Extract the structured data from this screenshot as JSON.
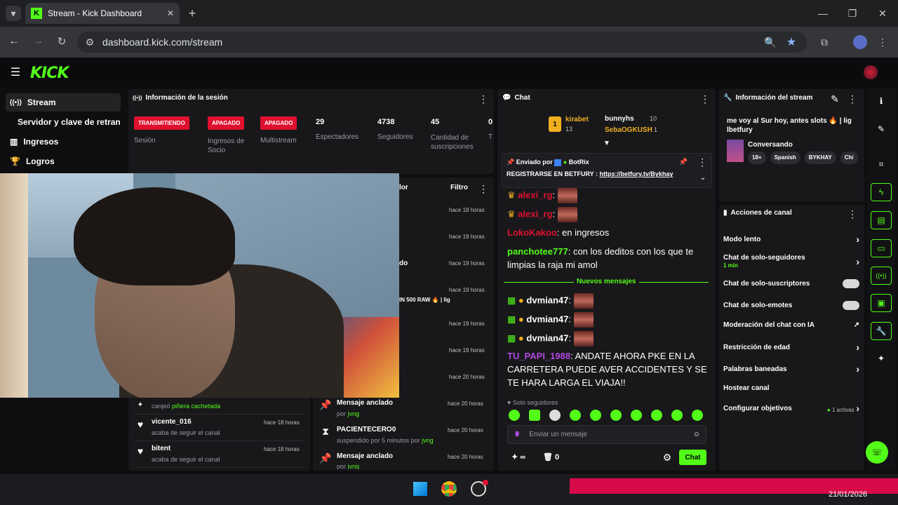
{
  "browser": {
    "tab_title": "Stream - Kick Dashboard",
    "url": "dashboard.kick.com/stream"
  },
  "nav": {
    "items": [
      "Stream",
      "Servidor y clave de retransm",
      "Ingresos",
      "Logros"
    ]
  },
  "session": {
    "title": "Información de la sesión",
    "stats": [
      {
        "badge": "TRANSMITIENDO",
        "label": "Sesión"
      },
      {
        "badge": "APAGADO",
        "label": "Ingresos de Socio"
      },
      {
        "badge": "APAGADO",
        "label": "Multistream"
      },
      {
        "value": "29",
        "label": "Espectadores"
      },
      {
        "value": "4738",
        "label": "Seguidores"
      },
      {
        "value": "45",
        "label": "Cantidad de suscripciones"
      },
      {
        "value": "0",
        "label": "T"
      }
    ]
  },
  "activity": {
    "filter": "Filtro",
    "header_frag": "lor",
    "right": [
      {
        "ago": "hace 18 horas"
      },
      {
        "ago": "hace 19 horas"
      },
      {
        "ago": "hace 19 horas",
        "frag": "do"
      },
      {
        "ago": "hace 19 horas",
        "frag": "IN 500 RAW 🔥 | lig"
      },
      {
        "ago": "hace 19 horas"
      },
      {
        "ago": "hace 19 horas"
      },
      {
        "ago": "hace 20 horas"
      },
      {
        "ago": "hace 20 horas",
        "name": "Mensaje anclado",
        "sub": "por",
        "subuser": "jvng"
      },
      {
        "ago": "hace 20 horas",
        "name": "PACIENTECERO0",
        "sub": "suspendido por 5 minutos por",
        "subuser": "jvng"
      },
      {
        "ago": "hace 20 horas",
        "name": "Mensaje anclado",
        "sub": "por",
        "subuser": "jvng"
      }
    ],
    "left": [
      {
        "name": "",
        "sub": "canjeó",
        "subuser": "piñera cachetada",
        "ago": ""
      },
      {
        "name": "vicente_016",
        "sub": "acaba de seguir el canal",
        "ago": "hace 18 horas"
      },
      {
        "name": "bitent",
        "sub": "acaba de seguir el canal",
        "ago": "hace 18 horas"
      }
    ]
  },
  "chat": {
    "title": "Chat",
    "top": [
      {
        "name": "kirabet",
        "count": "13",
        "rank": "1"
      },
      {
        "name": "bunnyhs",
        "count": "10"
      },
      {
        "name": "SebaOGKUSH",
        "count": "1"
      }
    ],
    "pinned": {
      "sent_by": "Enviado por",
      "bot": "BotRix",
      "text": "REGISTRARSE EN BETFURY : ",
      "link": "https://betfury.tv/Bykhay"
    },
    "messages": [
      {
        "user": "alexi_rg",
        "color": "#e0102f",
        "text": ""
      },
      {
        "user": "alexi_rg",
        "color": "#e0102f",
        "text": ""
      },
      {
        "user": "LokoKakoo",
        "color": "#e0102f",
        "text": "en ingresos"
      },
      {
        "user": "panchotee777",
        "color": "#53fc18",
        "text": "con los deditos con los que te limpias la raja mi amol"
      }
    ],
    "new_label": "Nuevos mensajes",
    "new_messages": [
      {
        "user": "dvmian47",
        "text": ""
      },
      {
        "user": "dvmian47",
        "text": ""
      },
      {
        "user": "dvmian47",
        "text": ""
      },
      {
        "user": "TU_PAPI_1988",
        "text": "ANDATE AHORA PKE EN LA CARRETERA PUEDE AVER ACCIDENTES Y SE TE HARA LARGA EL VIAJA!!"
      }
    ],
    "followers_only": "Solo seguidores",
    "input_placeholder": "Enviar un mensaje",
    "count": "0",
    "send": "Chat"
  },
  "stream_info": {
    "title": "Información del stream",
    "stream_title": "me voy al Sur hoy, antes slots 🔥 | lig lbetfury",
    "category": "Conversando",
    "tags": [
      "18+",
      "Spanish",
      "BYKHAY",
      "Chi"
    ]
  },
  "actions": {
    "title": "Acciones de canal",
    "items": [
      {
        "label": "Modo lento",
        "kind": "arrow"
      },
      {
        "label": "Chat de solo-seguidores",
        "sub": "1 min",
        "kind": "arrow"
      },
      {
        "label": "Chat de solo-suscriptores",
        "kind": "toggle"
      },
      {
        "label": "Chat de solo-emotes",
        "kind": "toggle"
      },
      {
        "label": "Moderación del chat con IA",
        "kind": "ext"
      },
      {
        "label": "Restricción de edad",
        "kind": "arrow"
      },
      {
        "label": "Palabras baneadas",
        "kind": "arrow"
      },
      {
        "label": "Hostear canal",
        "kind": "none"
      },
      {
        "label": "Configurar objetivos",
        "badge": "1 activas",
        "kind": "arrow"
      }
    ]
  },
  "taskbar": {
    "date": "21/01/2026"
  },
  "colors": {
    "accent": "#53fc18",
    "danger": "#e0102f",
    "panel": "#18181b"
  }
}
